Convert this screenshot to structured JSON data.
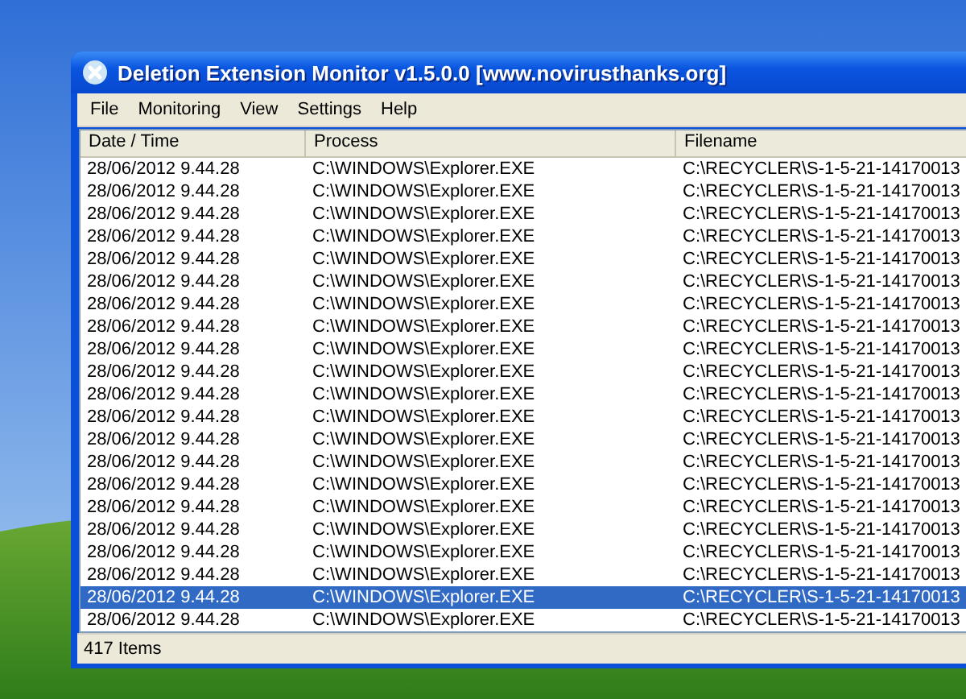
{
  "window": {
    "title": "Deletion Extension Monitor v1.5.0.0 [www.novirusthanks.org]"
  },
  "menu": [
    "File",
    "Monitoring",
    "View",
    "Settings",
    "Help"
  ],
  "table": {
    "columns": [
      "Date / Time",
      "Process",
      "Filename"
    ],
    "rows": [
      {
        "date": "28/06/2012 9.44.28",
        "process": "C:\\WINDOWS\\Explorer.EXE",
        "filename": "C:\\RECYCLER\\S-1-5-21-14170013",
        "selected": false
      },
      {
        "date": "28/06/2012 9.44.28",
        "process": "C:\\WINDOWS\\Explorer.EXE",
        "filename": "C:\\RECYCLER\\S-1-5-21-14170013",
        "selected": false
      },
      {
        "date": "28/06/2012 9.44.28",
        "process": "C:\\WINDOWS\\Explorer.EXE",
        "filename": "C:\\RECYCLER\\S-1-5-21-14170013",
        "selected": false
      },
      {
        "date": "28/06/2012 9.44.28",
        "process": "C:\\WINDOWS\\Explorer.EXE",
        "filename": "C:\\RECYCLER\\S-1-5-21-14170013",
        "selected": false
      },
      {
        "date": "28/06/2012 9.44.28",
        "process": "C:\\WINDOWS\\Explorer.EXE",
        "filename": "C:\\RECYCLER\\S-1-5-21-14170013",
        "selected": false
      },
      {
        "date": "28/06/2012 9.44.28",
        "process": "C:\\WINDOWS\\Explorer.EXE",
        "filename": "C:\\RECYCLER\\S-1-5-21-14170013",
        "selected": false
      },
      {
        "date": "28/06/2012 9.44.28",
        "process": "C:\\WINDOWS\\Explorer.EXE",
        "filename": "C:\\RECYCLER\\S-1-5-21-14170013",
        "selected": false
      },
      {
        "date": "28/06/2012 9.44.28",
        "process": "C:\\WINDOWS\\Explorer.EXE",
        "filename": "C:\\RECYCLER\\S-1-5-21-14170013",
        "selected": false
      },
      {
        "date": "28/06/2012 9.44.28",
        "process": "C:\\WINDOWS\\Explorer.EXE",
        "filename": "C:\\RECYCLER\\S-1-5-21-14170013",
        "selected": false
      },
      {
        "date": "28/06/2012 9.44.28",
        "process": "C:\\WINDOWS\\Explorer.EXE",
        "filename": "C:\\RECYCLER\\S-1-5-21-14170013",
        "selected": false
      },
      {
        "date": "28/06/2012 9.44.28",
        "process": "C:\\WINDOWS\\Explorer.EXE",
        "filename": "C:\\RECYCLER\\S-1-5-21-14170013",
        "selected": false
      },
      {
        "date": "28/06/2012 9.44.28",
        "process": "C:\\WINDOWS\\Explorer.EXE",
        "filename": "C:\\RECYCLER\\S-1-5-21-14170013",
        "selected": false
      },
      {
        "date": "28/06/2012 9.44.28",
        "process": "C:\\WINDOWS\\Explorer.EXE",
        "filename": "C:\\RECYCLER\\S-1-5-21-14170013",
        "selected": false
      },
      {
        "date": "28/06/2012 9.44.28",
        "process": "C:\\WINDOWS\\Explorer.EXE",
        "filename": "C:\\RECYCLER\\S-1-5-21-14170013",
        "selected": false
      },
      {
        "date": "28/06/2012 9.44.28",
        "process": "C:\\WINDOWS\\Explorer.EXE",
        "filename": "C:\\RECYCLER\\S-1-5-21-14170013",
        "selected": false
      },
      {
        "date": "28/06/2012 9.44.28",
        "process": "C:\\WINDOWS\\Explorer.EXE",
        "filename": "C:\\RECYCLER\\S-1-5-21-14170013",
        "selected": false
      },
      {
        "date": "28/06/2012 9.44.28",
        "process": "C:\\WINDOWS\\Explorer.EXE",
        "filename": "C:\\RECYCLER\\S-1-5-21-14170013",
        "selected": false
      },
      {
        "date": "28/06/2012 9.44.28",
        "process": "C:\\WINDOWS\\Explorer.EXE",
        "filename": "C:\\RECYCLER\\S-1-5-21-14170013",
        "selected": false
      },
      {
        "date": "28/06/2012 9.44.28",
        "process": "C:\\WINDOWS\\Explorer.EXE",
        "filename": "C:\\RECYCLER\\S-1-5-21-14170013",
        "selected": false
      },
      {
        "date": "28/06/2012 9.44.28",
        "process": "C:\\WINDOWS\\Explorer.EXE",
        "filename": "C:\\RECYCLER\\S-1-5-21-14170013",
        "selected": true
      },
      {
        "date": "28/06/2012 9.44.28",
        "process": "C:\\WINDOWS\\Explorer.EXE",
        "filename": "C:\\RECYCLER\\S-1-5-21-14170013",
        "selected": false
      }
    ]
  },
  "status_bar": {
    "text": "417 Items"
  }
}
